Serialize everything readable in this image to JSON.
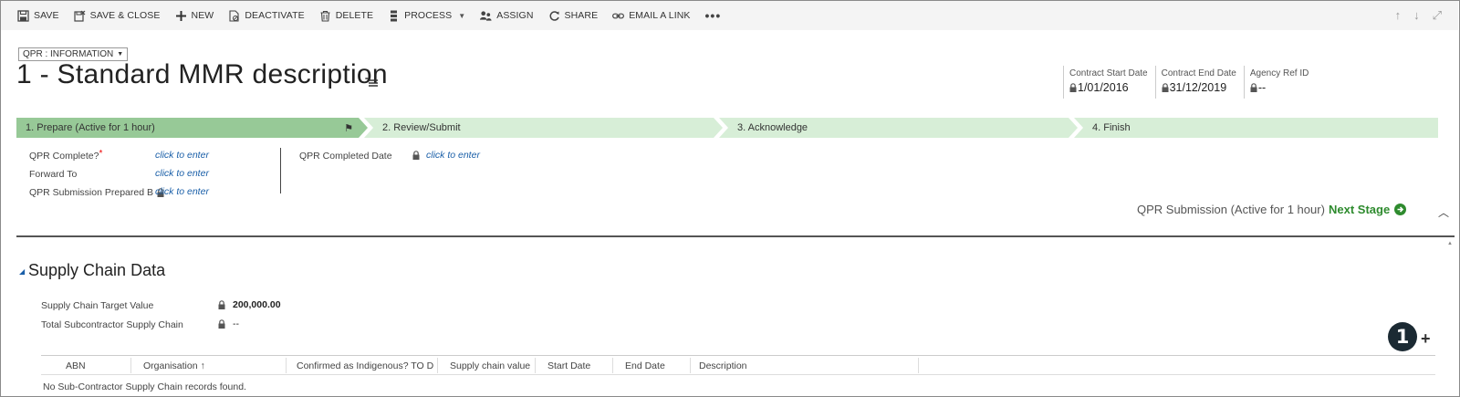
{
  "toolbar": {
    "save": "SAVE",
    "save_close": "SAVE & CLOSE",
    "new": "NEW",
    "deactivate": "DEACTIVATE",
    "delete": "DELETE",
    "process": "PROCESS",
    "assign": "ASSIGN",
    "share": "SHARE",
    "email_link": "EMAIL A LINK",
    "more": "•••"
  },
  "nav": {
    "up": "↑",
    "down": "↓",
    "popout": "⤢"
  },
  "header": {
    "form_selector": "QPR : INFORMATION",
    "title": "1 - Standard MMR description",
    "fields": [
      {
        "label": "Contract Start Date",
        "value": "1/01/2016"
      },
      {
        "label": "Contract End Date",
        "value": "31/12/2019"
      },
      {
        "label": "Agency Ref ID",
        "value": "--"
      }
    ]
  },
  "process": {
    "stages": [
      {
        "label": "1. Prepare (Active for 1 hour)",
        "active": true
      },
      {
        "label": "2. Review/Submit",
        "active": false
      },
      {
        "label": "3. Acknowledge",
        "active": false
      },
      {
        "label": "4. Finish",
        "active": false
      }
    ],
    "fields": [
      {
        "label": "QPR Complete?",
        "value": "click to enter",
        "required": "*"
      },
      {
        "label": "Forward To",
        "value": "click to enter"
      },
      {
        "label": "QPR Submission Prepared B",
        "value": "click to enter"
      },
      {
        "label": "QPR Completed Date",
        "value": "click to enter"
      }
    ],
    "status": "QPR Submission (Active for 1 hour)",
    "next_stage": "Next Stage",
    "colors": {
      "active": "#97c997",
      "inactive": "#d7eed7",
      "next": "#2e8b2e"
    }
  },
  "section": {
    "title": "Supply Chain Data",
    "fields": [
      {
        "label": "Supply Chain Target Value",
        "value": "200,000.00"
      },
      {
        "label": "Total Subcontractor Supply Chain",
        "value": "--"
      }
    ],
    "badge": "1",
    "add": "+",
    "grid": {
      "columns": [
        "ABN",
        "Organisation ↑",
        "Confirmed as Indigenous? TO DE...",
        "Supply chain value",
        "Start Date",
        "End Date",
        "Description"
      ],
      "empty_message": "No Sub-Contractor Supply Chain records found."
    }
  }
}
